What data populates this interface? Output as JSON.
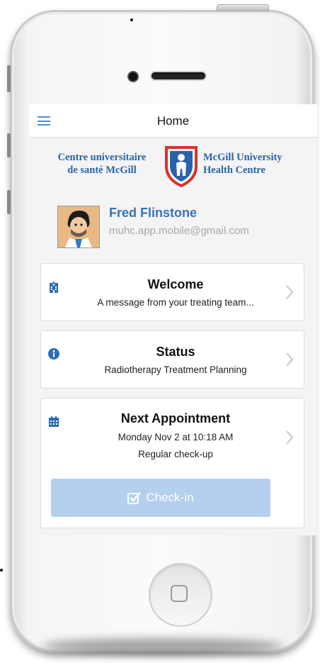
{
  "navbar": {
    "title": "Home"
  },
  "logo": {
    "fr_line1": "Centre universitaire",
    "fr_line2": "de santé McGill",
    "en_line1": "McGill University",
    "en_line2": "Health Centre"
  },
  "profile": {
    "name": "Fred Flinstone",
    "email": "muhc.app.mobile@gmail.com"
  },
  "cards": {
    "welcome": {
      "title": "Welcome",
      "line": "A message from your treating team..."
    },
    "status": {
      "title": "Status",
      "line": "Radiotherapy Treatment Planning"
    },
    "appointment": {
      "title": "Next Appointment",
      "line1": "Monday Nov 2 at 10:18 AM",
      "line2": "Regular check-up"
    }
  },
  "checkin": {
    "label": "Check-in",
    "state": "disabled"
  },
  "icons": {
    "menu": "hamburger-icon",
    "welcome": "hospital-icon",
    "status": "info-icon",
    "appointment": "calendar-icon",
    "checkin": "checkbox-icon",
    "chevron": "chevron-right-icon"
  },
  "colors": {
    "accent": "#2d6eb5",
    "checkin_bg": "#b4d0ee",
    "logo_red": "#d8342a"
  }
}
